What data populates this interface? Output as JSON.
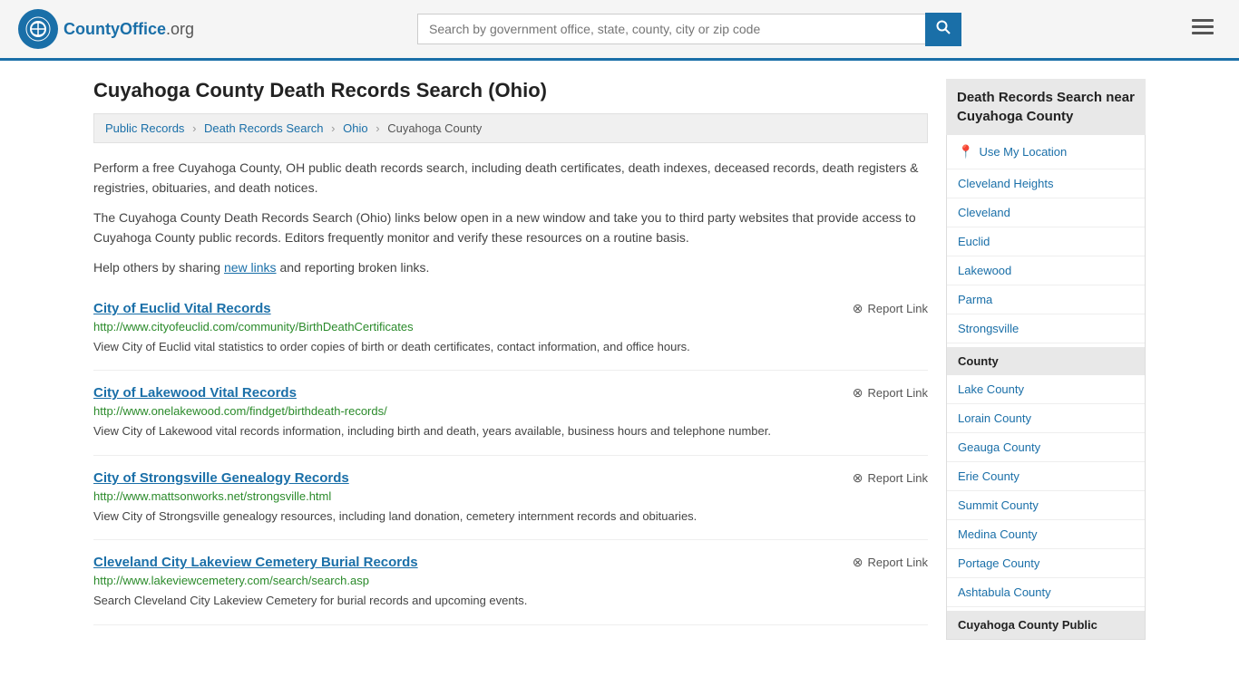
{
  "header": {
    "logo_text": "CountyOffice",
    "logo_domain": ".org",
    "search_placeholder": "Search by government office, state, county, city or zip code",
    "search_value": ""
  },
  "page": {
    "title": "Cuyahoga County Death Records Search (Ohio)",
    "breadcrumb": {
      "items": [
        "Public Records",
        "Death Records Search",
        "Ohio",
        "Cuyahoga County"
      ]
    },
    "description1": "Perform a free Cuyahoga County, OH public death records search, including death certificates, death indexes, deceased records, death registers & registries, obituaries, and death notices.",
    "description2": "The Cuyahoga County Death Records Search (Ohio) links below open in a new window and take you to third party websites that provide access to Cuyahoga County public records. Editors frequently monitor and verify these resources on a routine basis.",
    "description3_prefix": "Help others by sharing ",
    "description3_link": "new links",
    "description3_suffix": " and reporting broken links.",
    "records": [
      {
        "title": "City of Euclid Vital Records",
        "url": "http://www.cityofeuclid.com/community/BirthDeathCertificates",
        "description": "View City of Euclid vital statistics to order copies of birth or death certificates, contact information, and office hours.",
        "report": "Report Link"
      },
      {
        "title": "City of Lakewood Vital Records",
        "url": "http://www.onelakewood.com/findget/birthdeath-records/",
        "description": "View City of Lakewood vital records information, including birth and death, years available, business hours and telephone number.",
        "report": "Report Link"
      },
      {
        "title": "City of Strongsville Genealogy Records",
        "url": "http://www.mattsonworks.net/strongsville.html",
        "description": "View City of Strongsville genealogy resources, including land donation, cemetery internment records and obituaries.",
        "report": "Report Link"
      },
      {
        "title": "Cleveland City Lakeview Cemetery Burial Records",
        "url": "http://www.lakeviewcemetery.com/search/search.asp",
        "description": "Search Cleveland City Lakeview Cemetery for burial records and upcoming events.",
        "report": "Report Link"
      }
    ]
  },
  "sidebar": {
    "title": "Death Records Search near Cuyahoga County",
    "use_my_location": "Use My Location",
    "cities": [
      "Cleveland Heights",
      "Cleveland",
      "Euclid",
      "Lakewood",
      "Parma",
      "Strongsville"
    ],
    "county_header": "County",
    "counties": [
      "Lake County",
      "Lorain County",
      "Geauga County",
      "Erie County",
      "Summit County",
      "Medina County",
      "Portage County",
      "Ashtabula County"
    ],
    "public_records_header": "Cuyahoga County Public"
  }
}
